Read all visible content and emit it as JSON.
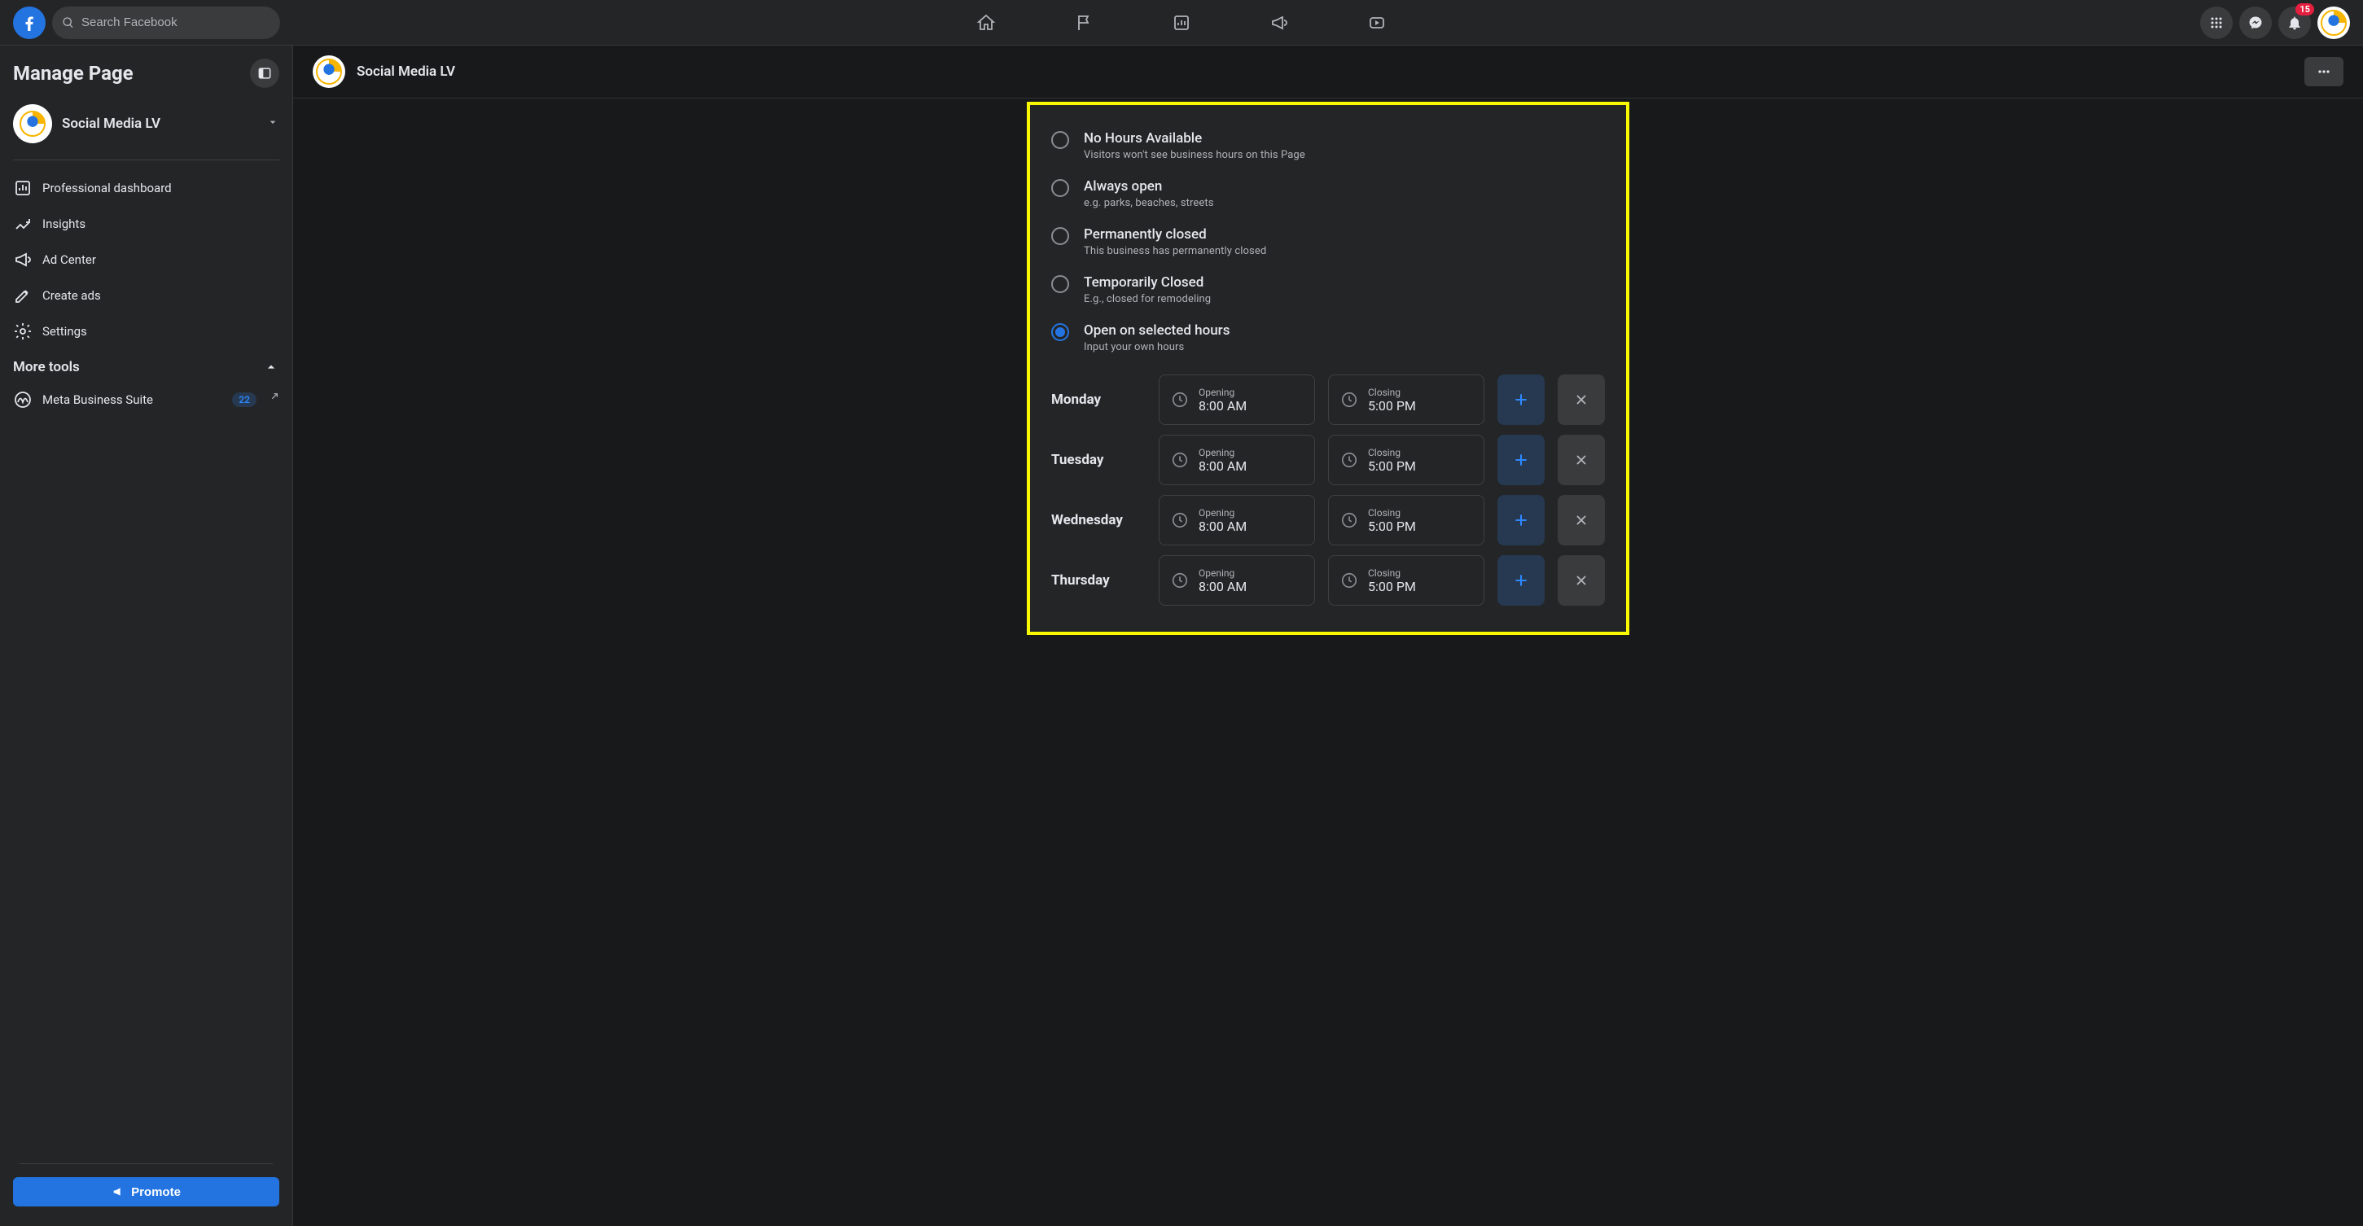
{
  "header": {
    "search_placeholder": "Search Facebook",
    "notification_count": "15"
  },
  "sidebar": {
    "title": "Manage Page",
    "page_name": "Social Media LV",
    "items": [
      {
        "label": "Professional dashboard"
      },
      {
        "label": "Insights"
      },
      {
        "label": "Ad Center"
      },
      {
        "label": "Create ads"
      },
      {
        "label": "Settings"
      }
    ],
    "more_tools_label": "More tools",
    "meta_suite": {
      "label": "Meta Business Suite",
      "count": "22"
    },
    "promote_label": "Promote"
  },
  "page_bar": {
    "title": "Social Media LV"
  },
  "hours": {
    "options": [
      {
        "title": "No Hours Available",
        "sub": "Visitors won't see business hours on this Page"
      },
      {
        "title": "Always open",
        "sub": "e.g. parks, beaches, streets"
      },
      {
        "title": "Permanently closed",
        "sub": "This business has permanently closed"
      },
      {
        "title": "Temporarily Closed",
        "sub": "E.g., closed for remodeling"
      },
      {
        "title": "Open on selected hours",
        "sub": "Input your own hours"
      }
    ],
    "opening_label": "Opening",
    "closing_label": "Closing",
    "days": [
      {
        "name": "Monday",
        "open": "8:00 AM",
        "close": "5:00 PM"
      },
      {
        "name": "Tuesday",
        "open": "8:00 AM",
        "close": "5:00 PM"
      },
      {
        "name": "Wednesday",
        "open": "8:00 AM",
        "close": "5:00 PM"
      },
      {
        "name": "Thursday",
        "open": "8:00 AM",
        "close": "5:00 PM"
      }
    ]
  }
}
